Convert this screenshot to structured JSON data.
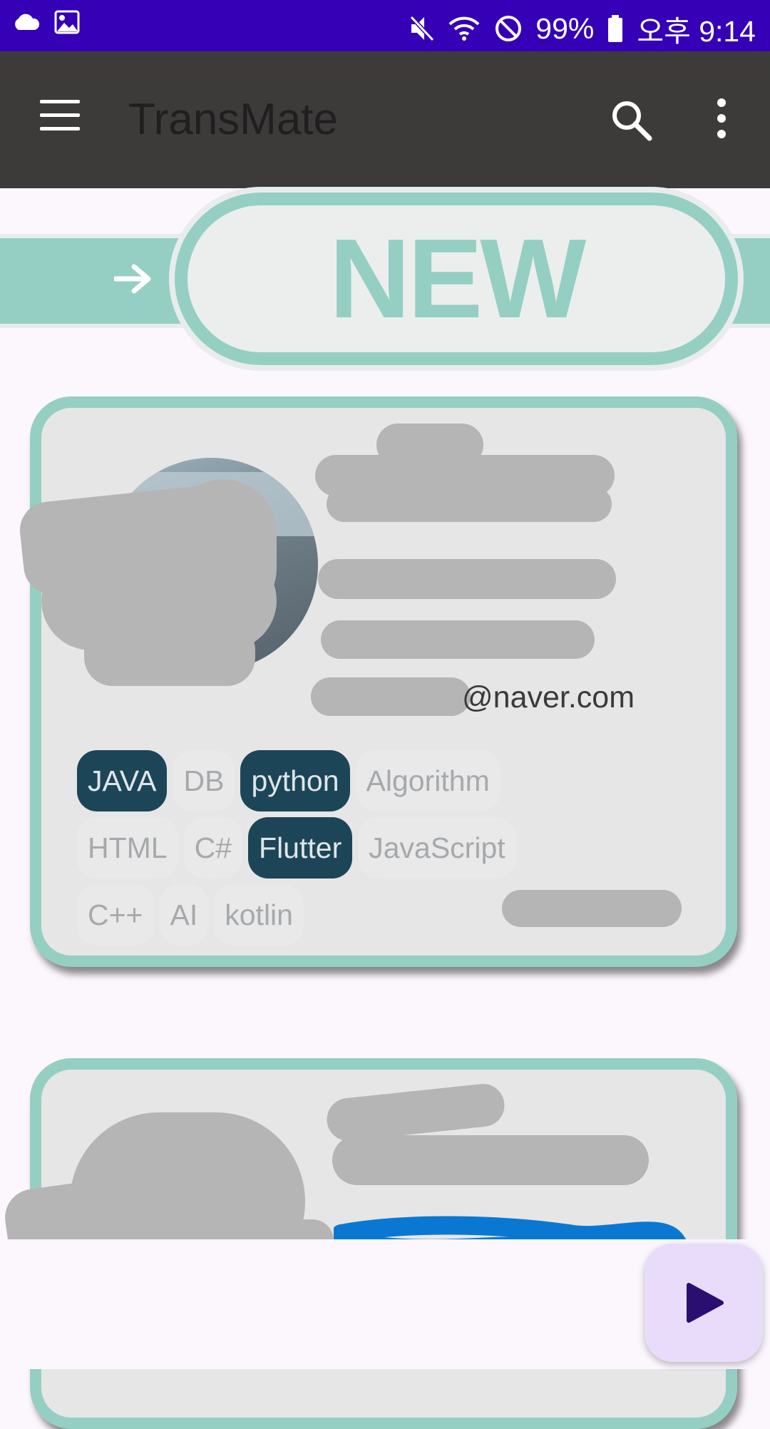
{
  "status_bar": {
    "battery": "99%",
    "time": "오후 9:14",
    "background": "#3500b6",
    "icons": [
      "cloud-icon",
      "image-icon",
      "mute-icon",
      "wifi-icon",
      "do-not-disturb-icon",
      "battery-icon"
    ]
  },
  "app_bar": {
    "title": "TransMate",
    "background": "#3d3a3a",
    "icons": [
      "menu-icon",
      "search-icon",
      "more-vert-icon"
    ]
  },
  "banner": {
    "text": "NEW",
    "accent": "#95cfc4"
  },
  "cards": [
    {
      "email_suffix": "@naver.com",
      "skill_tags": [
        [
          {
            "label": "JAVA",
            "selected": true
          },
          {
            "label": "DB",
            "selected": false
          },
          {
            "label": "python",
            "selected": true
          },
          {
            "label": "Algorithm",
            "selected": false
          }
        ],
        [
          {
            "label": "HTML",
            "selected": false
          },
          {
            "label": "C#",
            "selected": false
          },
          {
            "label": "Flutter",
            "selected": true
          },
          {
            "label": "JavaScript",
            "selected": false
          }
        ],
        [
          {
            "label": "C++",
            "selected": false
          },
          {
            "label": "AI",
            "selected": false
          },
          {
            "label": "kotlin",
            "selected": false
          }
        ]
      ]
    }
  ],
  "colors": {
    "card_border": "#95cfc4",
    "card_background": "#e6e6e6",
    "tag_selected": "#1d4558",
    "fab_background": "#e9dcfa",
    "fab_icon": "#2a0f70"
  },
  "fab": {
    "icon": "play-arrow-icon"
  }
}
